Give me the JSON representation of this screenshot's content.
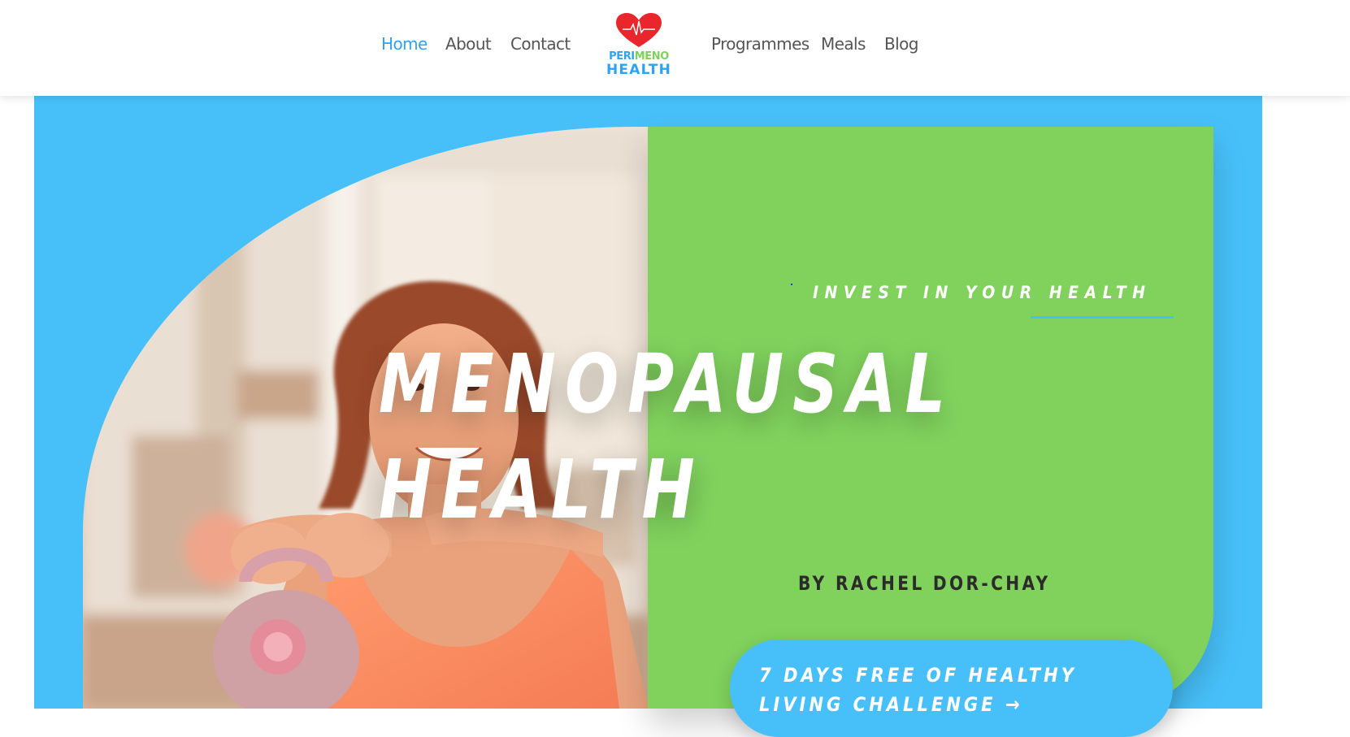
{
  "nav": {
    "left_items": [
      {
        "label": "Home",
        "active": true
      },
      {
        "label": "About"
      },
      {
        "label": "Contact"
      }
    ],
    "right_items": [
      {
        "label": "Programmes"
      },
      {
        "label": "Meals"
      },
      {
        "label": "Blog"
      }
    ]
  },
  "logo": {
    "peri": "PERI",
    "meno": "MENO",
    "health": "HEALTH",
    "icon": "heart-pulse-icon"
  },
  "hero": {
    "tagline": "INVEST IN YOUR HEALTH",
    "title_line1": "MENOPAUSAL",
    "title_line2": "HEALTH",
    "byline": "BY RACHEL DOR-CHAY",
    "cta_label": "7 DAYS FREE OF HEALTHY LIVING CHALLENGE",
    "cta_arrow": "→",
    "photo_subject": "woman-with-kettlebell-photo"
  },
  "colors": {
    "accent_blue": "#47c0f9",
    "nav_active": "#2ea3f2",
    "panel_green": "#80d25d",
    "logo_heart": "#e8262b",
    "text_dark": "#2b2b2b"
  }
}
